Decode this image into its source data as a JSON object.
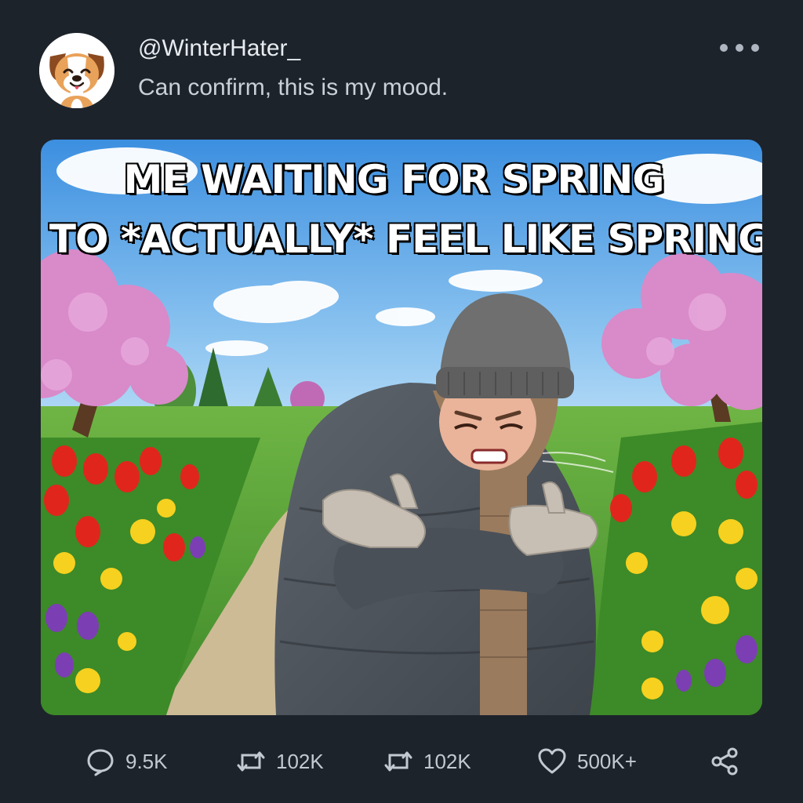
{
  "post": {
    "handle": "@WinterHater_",
    "text": "Can confirm, this is my mood.",
    "avatar_icon": "cartoon-dog-icon",
    "more_icon": "more-options-icon"
  },
  "media": {
    "caption_line1": "ME WAITING FOR SPRING",
    "caption_line2": "TO *ACTUALLY* FEEL LIKE SPRING",
    "description_icon": "meme-image"
  },
  "actions": {
    "reply_count": "9.5K",
    "retweet_count_1": "102K",
    "retweet_count_2": "102K",
    "like_count": "500K+",
    "icons": [
      "reply-icon",
      "retweet-icon",
      "retweet-icon",
      "heart-icon",
      "share-icon"
    ]
  },
  "colors": {
    "background": "#1d232b",
    "text_primary": "#e7ecf1",
    "text_secondary": "#c9d0d8",
    "icon": "#c2c9d1"
  }
}
